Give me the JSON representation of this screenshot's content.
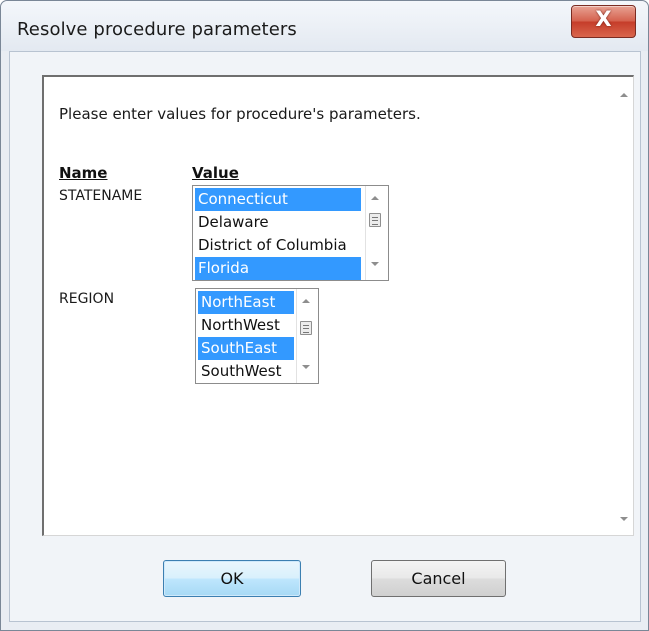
{
  "window": {
    "title": "Resolve procedure parameters",
    "close_glyph": "X"
  },
  "form": {
    "intro": "Please enter values for procedure's parameters.",
    "name_header": "Name",
    "value_header": "Value",
    "parameters": [
      {
        "name": "STATENAME",
        "options": [
          {
            "label": "Connecticut",
            "selected": true
          },
          {
            "label": "Delaware",
            "selected": false
          },
          {
            "label": "District of Columbia",
            "selected": false
          },
          {
            "label": "Florida",
            "selected": true
          }
        ]
      },
      {
        "name": "REGION",
        "options": [
          {
            "label": "NorthEast",
            "selected": true
          },
          {
            "label": "NorthWest",
            "selected": false
          },
          {
            "label": "SouthEast",
            "selected": true
          },
          {
            "label": "SouthWest",
            "selected": false
          }
        ]
      }
    ]
  },
  "buttons": {
    "ok_label": "OK",
    "cancel_label": "Cancel"
  },
  "colors": {
    "selection": "#3399ff",
    "close_button": "#c53d2a",
    "default_button": "#bee6fd"
  },
  "icons": [
    "close-icon",
    "scroll-up-arrow-icon",
    "scroll-down-arrow-icon",
    "scroll-thumb-grip-icon"
  ]
}
